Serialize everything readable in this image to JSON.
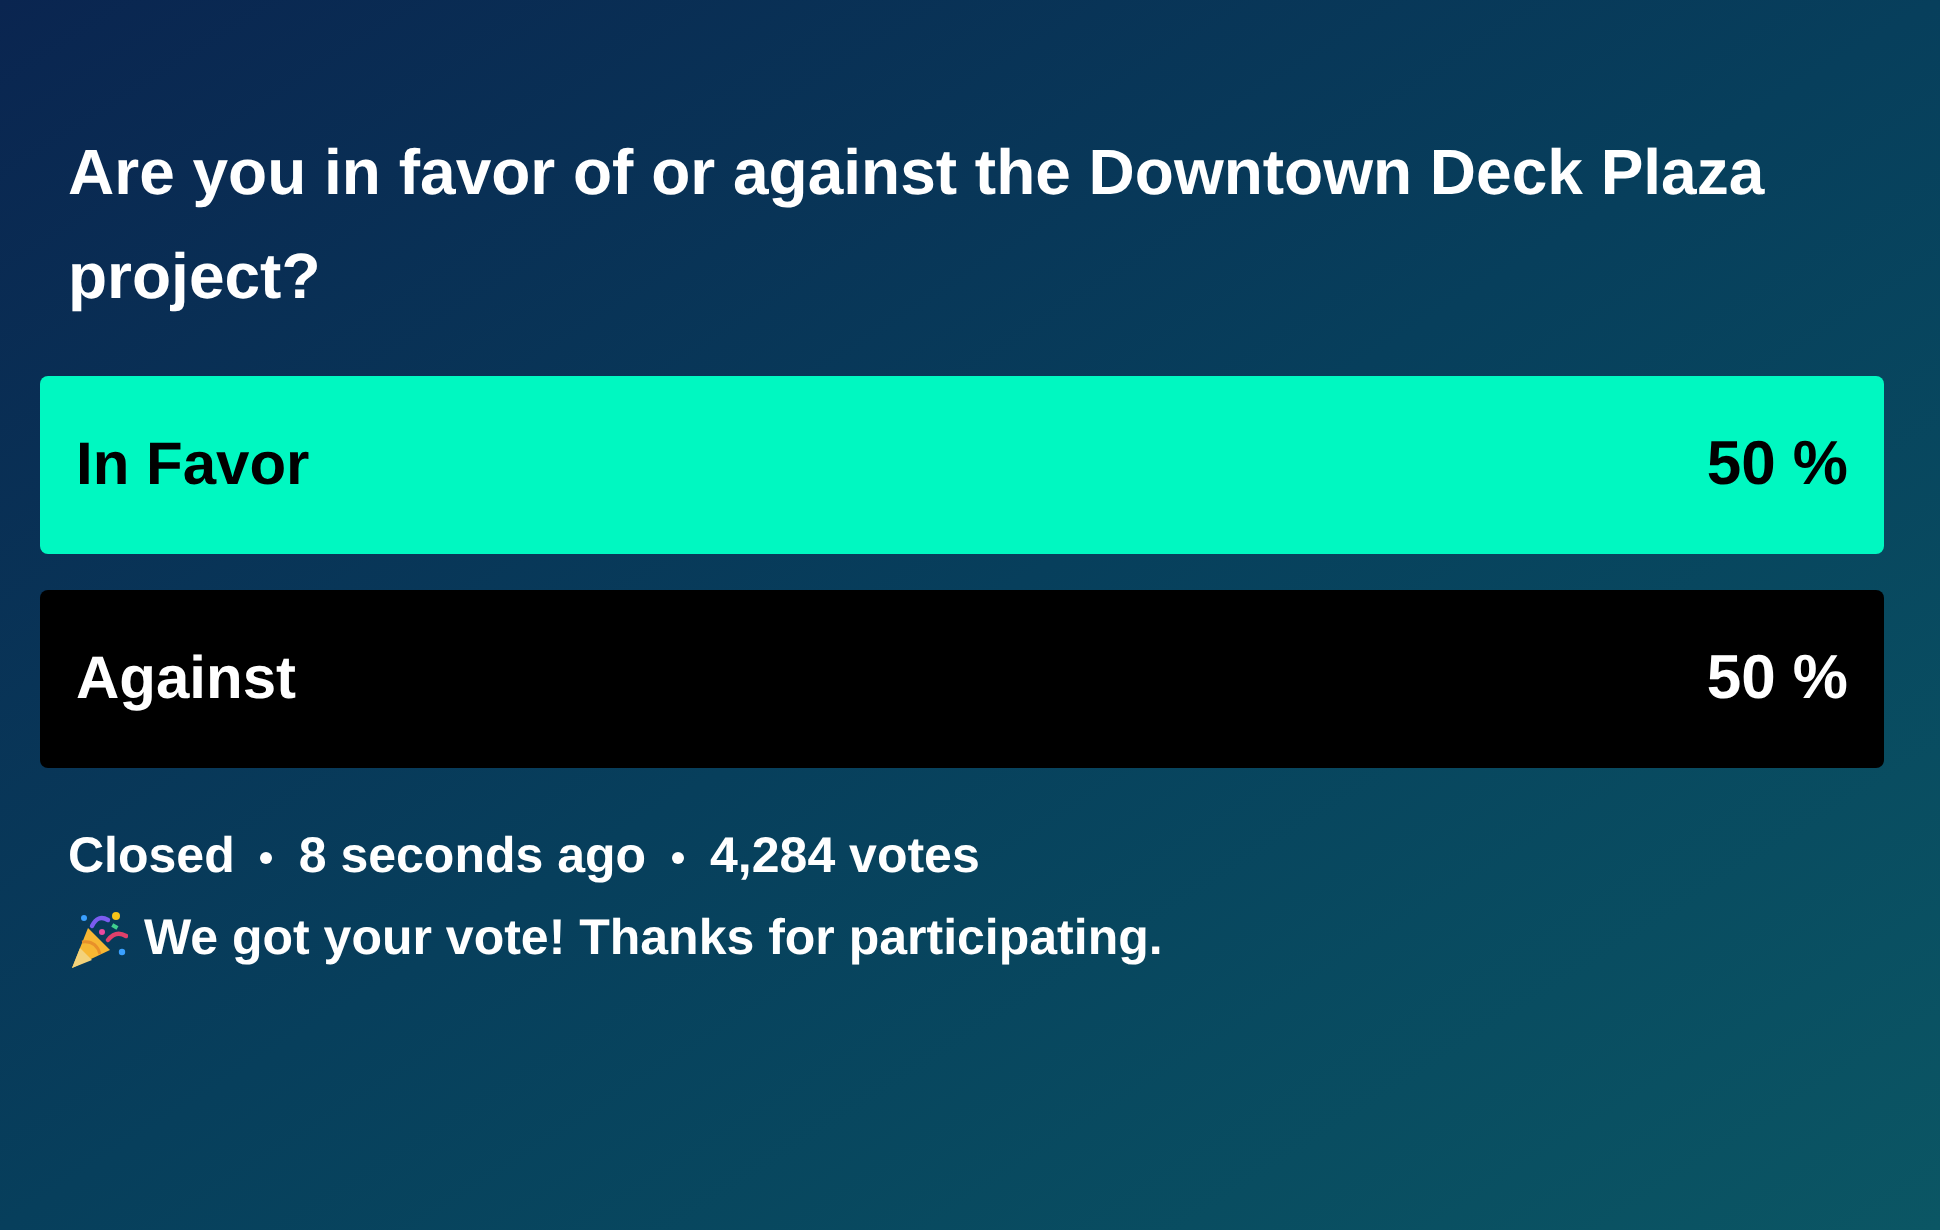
{
  "question": "Are you in favor of or against the Downtown Deck Plaza project?",
  "options": [
    {
      "label": "In Favor",
      "percent": "50 %",
      "selected": true
    },
    {
      "label": "Against",
      "percent": "50 %",
      "selected": false
    }
  ],
  "status": {
    "state": "Closed",
    "time": "8 seconds ago",
    "votes": "4,284 votes"
  },
  "confirmation": {
    "message": "We got your vote! Thanks for participating."
  }
}
